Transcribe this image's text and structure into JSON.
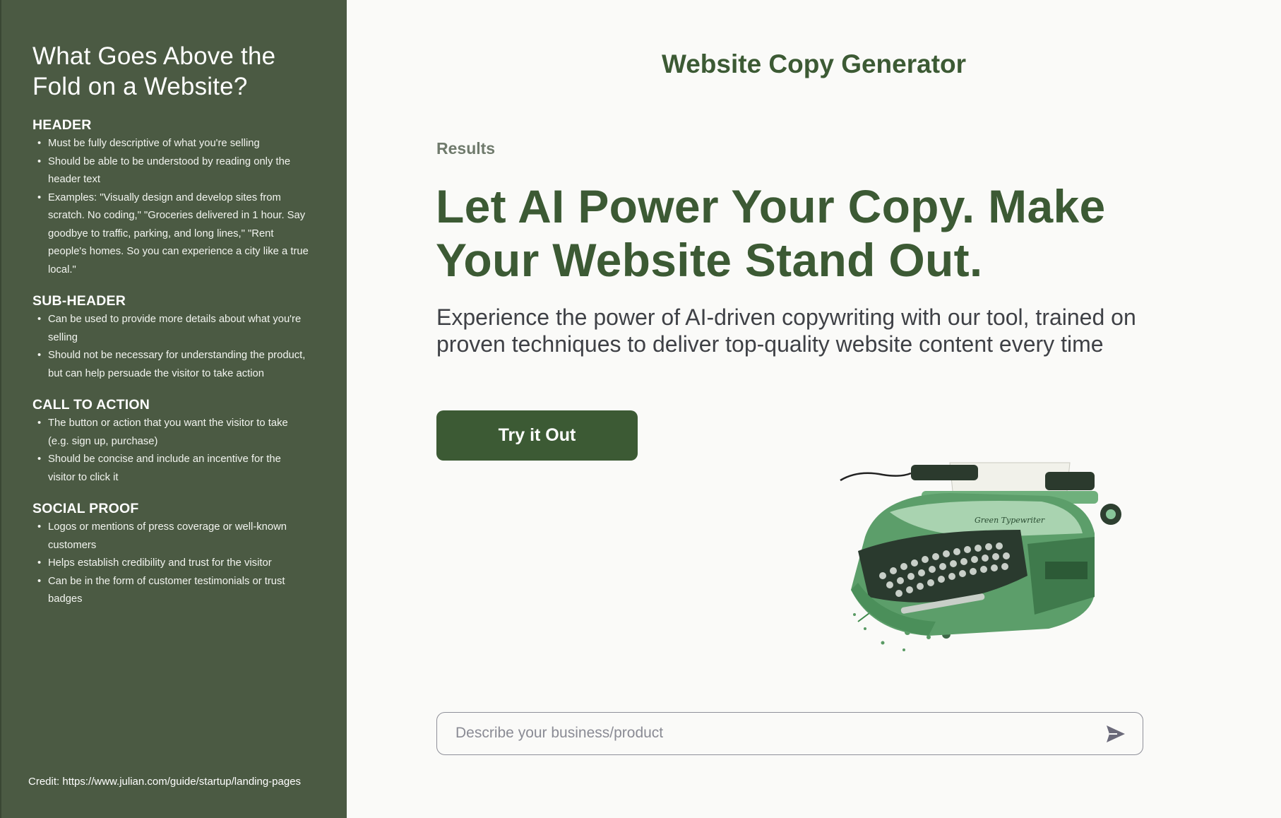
{
  "sidebar": {
    "title": "What Goes Above the Fold on a Website?",
    "sections": [
      {
        "heading": "HEADER",
        "items": [
          "Must be fully descriptive of what you're selling",
          "Should be able to be understood by reading only the header text",
          "Examples: \"Visually design and develop sites from scratch. No coding,\" \"Groceries delivered in 1 hour. Say goodbye to traffic, parking, and long lines,\" \"Rent people's homes. So you can experience a city like a true local.\""
        ]
      },
      {
        "heading": "SUB-HEADER",
        "items": [
          "Can be used to provide more details about what you're selling",
          "Should not be necessary for understanding the product, but can help persuade the visitor to take action"
        ]
      },
      {
        "heading": "CALL TO ACTION",
        "items": [
          "The button or action that you want the visitor to take (e.g. sign up, purchase)",
          "Should be concise and include an incentive for the visitor to click it"
        ]
      },
      {
        "heading": "SOCIAL PROOF",
        "items": [
          "Logos or mentions of press coverage or well-known customers",
          "Helps establish credibility and trust for the visitor",
          "Can be in the form of customer testimonials or trust badges"
        ]
      }
    ],
    "credit": "Credit: https://www.julian.com/guide/startup/landing-pages"
  },
  "main": {
    "title": "Website Copy Generator",
    "results_label": "Results",
    "headline": "Let AI Power Your Copy. Make Your Website Stand Out.",
    "subtext": "Experience the power of AI-driven copywriting with our tool, trained on proven techniques to deliver top-quality website content every time",
    "cta_label": "Try it Out",
    "image_icon": "typewriter-illustration"
  },
  "input": {
    "placeholder": "Describe your business/product",
    "value": "",
    "send_icon": "send-icon"
  },
  "colors": {
    "sidebar_bg": "#4b5a43",
    "brand_green": "#3c5a34",
    "page_bg": "#fafaf8"
  }
}
